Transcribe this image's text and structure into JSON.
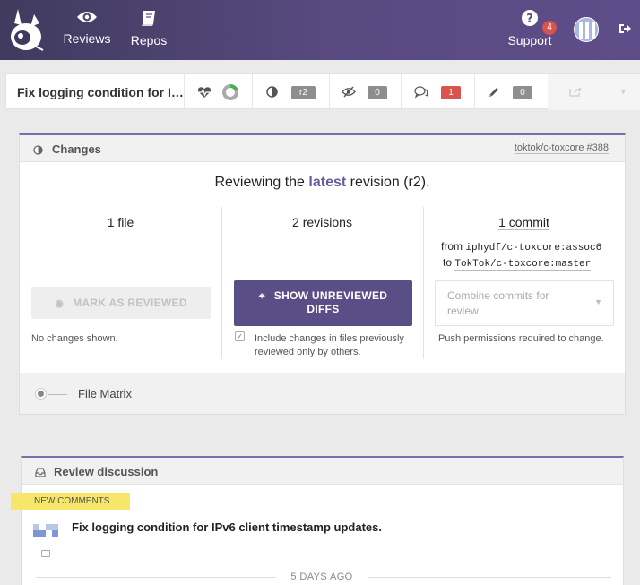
{
  "nav": {
    "reviews_label": "Reviews",
    "repos_label": "Repos",
    "support_label": "Support",
    "support_badge": "4",
    "icons": [
      "logo-icon",
      "eye-icon",
      "book-icon",
      "question-icon",
      "logout-icon"
    ]
  },
  "toolbar": {
    "title": "Fix logging condition for IPv6 client timestamp updates.",
    "revision_pill": "r2",
    "unreviewed_count": "0",
    "comments_count": "1",
    "drafts_count": "0",
    "progress_fraction": 0.2
  },
  "changes": {
    "title": "Changes",
    "repo_link": "toktok/c-toxcore #388",
    "reviewing_prefix": "Reviewing the",
    "reviewing_latest": "latest",
    "reviewing_suffix": "revision (r2).",
    "files_label": "1 file",
    "revisions_label": "2 revisions",
    "commits_label": "1 commit",
    "from_word": "from",
    "from_branch": "iphydf/c-toxcore:assoc6",
    "to_word": "to",
    "to_branch": "TokTok/c-toxcore:master",
    "mark_reviewed_button": "MARK AS REVIEWED",
    "show_unreviewed_line1": "SHOW UNREVIEWED",
    "show_unreviewed_line2": "DIFFS",
    "combine_placeholder_line1": "Combine commits for",
    "combine_placeholder_line2": "review",
    "no_changes": "No changes shown.",
    "include_changes_line1": "Include changes in files previously",
    "include_changes_line2": "reviewed only by others.",
    "push_permissions": "Push permissions required to change.",
    "file_matrix_label": "File Matrix"
  },
  "discussion": {
    "title": "Review discussion",
    "new_comments_flag": "NEW COMMENTS",
    "comment_title": "Fix logging condition for IPv6 client timestamp updates.",
    "time_ago": "5 DAYS AGO"
  },
  "colors": {
    "accent": "#5a4e86",
    "badge_red": "#d9534f",
    "flag_yellow": "#f6e66a"
  }
}
